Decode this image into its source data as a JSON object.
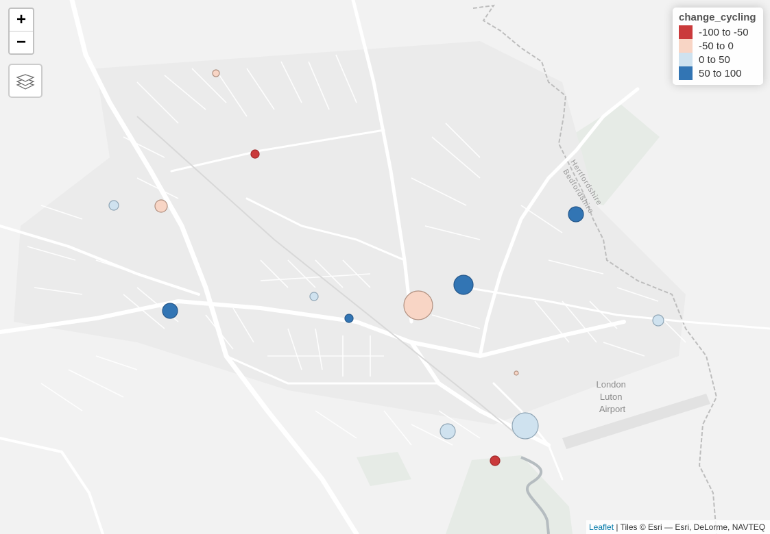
{
  "zoom": {
    "in_label": "+",
    "out_label": "−"
  },
  "layers_control": {
    "icon": "layers-icon"
  },
  "legend": {
    "title": "change_cycling",
    "items": [
      {
        "label": "-100 to -50",
        "color": "#ca3a3b"
      },
      {
        "label": "-50 to 0",
        "color": "#f8d5c5"
      },
      {
        "label": "0 to 50",
        "color": "#cfe2ef"
      },
      {
        "label": "50 to 100",
        "color": "#3275b4"
      }
    ]
  },
  "map_labels": {
    "airport": "London\nLuton\nAirport",
    "boundary_north": "Hertfordshire",
    "boundary_south": "Bedfordshire"
  },
  "attribution": {
    "leaflet_link": "Leaflet",
    "text": " | Tiles © Esri — Esri, DeLorme, NAVTEQ"
  }
}
